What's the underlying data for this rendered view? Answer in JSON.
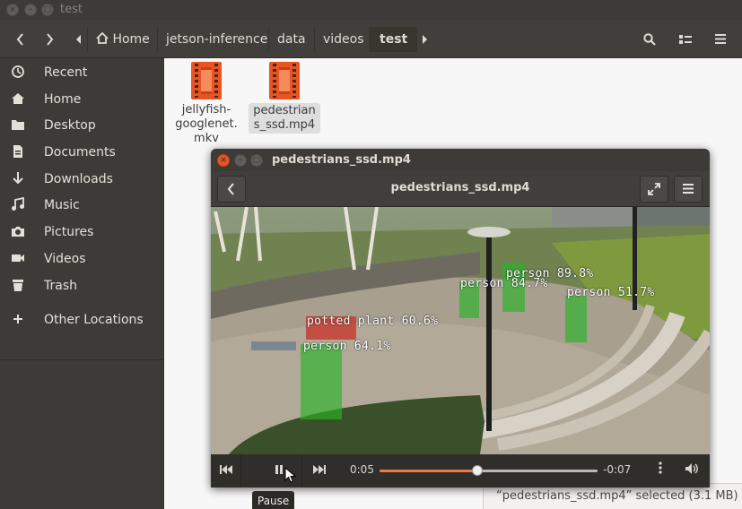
{
  "window": {
    "title": "test"
  },
  "toolbar": {
    "back_icon": "chevron-left-icon",
    "forward_icon": "chevron-right-icon",
    "breadcrumbs": [
      "Home",
      "jetson-inference",
      "data",
      "videos",
      "test"
    ],
    "home_icon": "home-icon"
  },
  "sidebar": {
    "items": [
      {
        "label": "Recent",
        "icon": "clock-icon"
      },
      {
        "label": "Home",
        "icon": "home-icon"
      },
      {
        "label": "Desktop",
        "icon": "folder-icon"
      },
      {
        "label": "Documents",
        "icon": "document-icon"
      },
      {
        "label": "Downloads",
        "icon": "download-icon"
      },
      {
        "label": "Music",
        "icon": "music-icon"
      },
      {
        "label": "Pictures",
        "icon": "camera-icon"
      },
      {
        "label": "Videos",
        "icon": "video-icon"
      },
      {
        "label": "Trash",
        "icon": "trash-icon"
      },
      {
        "label": "Other Locations",
        "icon": "plus-icon"
      }
    ]
  },
  "files": [
    {
      "name": "jellyfish-googlenet.mkv",
      "display": "jellyfish-\ngooglenet.\nmkv"
    },
    {
      "name": "pedestrians_ssd.mp4",
      "display": "pedestrian\ns_ssd.mp4",
      "selected": true
    }
  ],
  "status": {
    "text": "“pedestrians_ssd.mp4” selected  (3.1 MB)"
  },
  "player": {
    "window_title": "pedestrians_ssd.mp4",
    "header_title": "pedestrians_ssd.mp4",
    "elapsed": "0:05",
    "remaining": "-0:07",
    "progress": 0.45,
    "tooltip": "Pause",
    "detections": [
      {
        "label": "person 89.8%"
      },
      {
        "label": "person 84.7%"
      },
      {
        "label": "person 51.7%"
      },
      {
        "label": "potted plant 60.6%"
      },
      {
        "label": "person 64.1%"
      }
    ]
  },
  "colors": {
    "accent": "#e95420",
    "progress": "#f07746",
    "detection": "#28b428",
    "plant_detection": "#c0392b"
  }
}
